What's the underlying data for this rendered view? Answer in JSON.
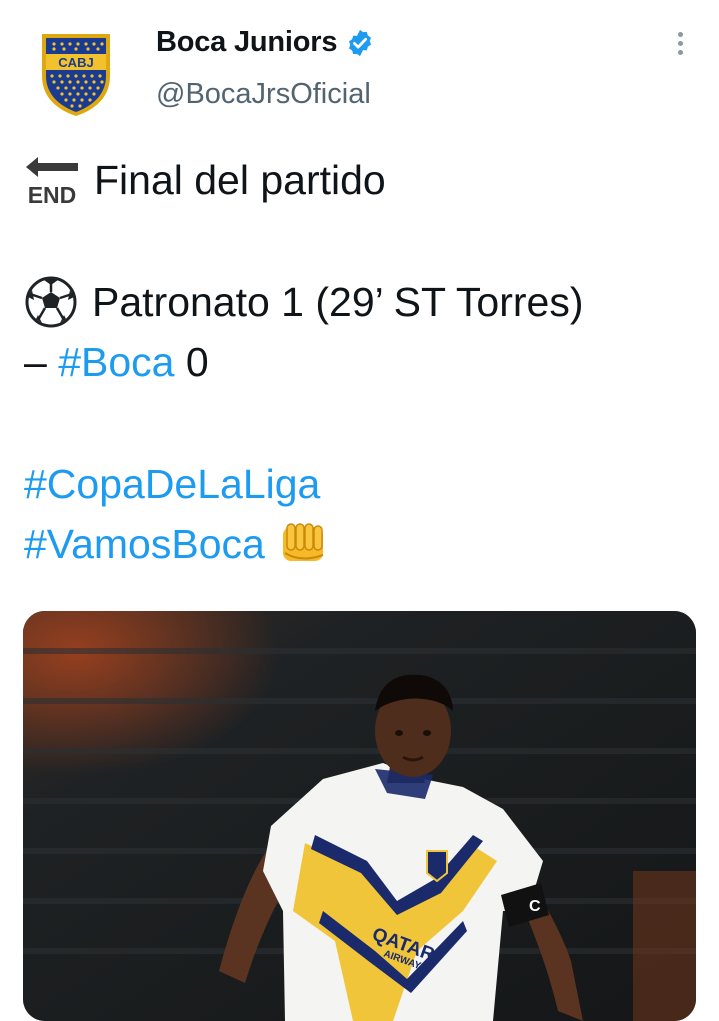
{
  "author": {
    "display_name": "Boca Juniors",
    "handle": "@BocaJrsOficial",
    "avatar_text": "CABJ",
    "verified": true
  },
  "tweet": {
    "line1": "Final del partido",
    "line2": "Patronato 1 (29’ ST Torres)",
    "line3_dash": "– ",
    "line3_hashtag": "#Boca",
    "line3_score": " 0",
    "hashtag1": "#CopaDeLaLiga",
    "hashtag2": "#VamosBoca"
  },
  "icons": {
    "end_arrow": "end-arrow-emoji",
    "soccer_ball": "soccer-ball-emoji",
    "fist": "oncoming-fist-emoji",
    "more": "more-options-icon"
  },
  "media": {
    "shirt_sponsor": "QATAR",
    "shirt_sponsor_sub": "AIRWAYS",
    "armband": "C"
  },
  "colors": {
    "link": "#1d9bf0",
    "handle": "#536471",
    "verified": "#1d9bf0",
    "boca_blue": "#1a3b8f",
    "boca_gold": "#f2c12e"
  }
}
